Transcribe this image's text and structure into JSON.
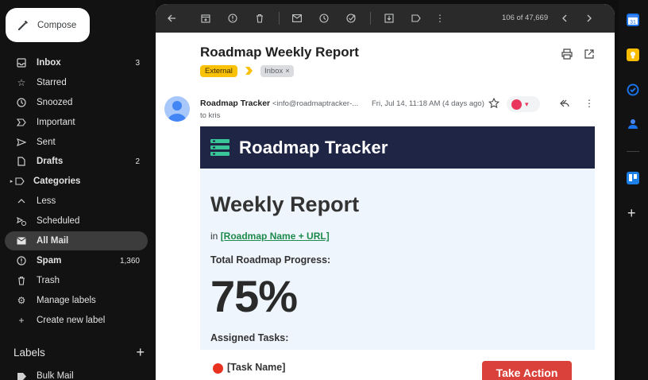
{
  "compose": {
    "label": "Compose"
  },
  "nav": {
    "items": [
      {
        "label": "Inbox",
        "count": "3",
        "icon": "inbox-icon"
      },
      {
        "label": "Starred",
        "count": "",
        "icon": "star-icon"
      },
      {
        "label": "Snoozed",
        "count": "",
        "icon": "clock-icon"
      },
      {
        "label": "Important",
        "count": "",
        "icon": "important-icon"
      },
      {
        "label": "Sent",
        "count": "",
        "icon": "send-icon"
      },
      {
        "label": "Drafts",
        "count": "2",
        "icon": "draft-icon"
      },
      {
        "label": "Categories",
        "count": "",
        "icon": "label-icon"
      },
      {
        "label": "Less",
        "count": "",
        "icon": "chevron-up-icon"
      },
      {
        "label": "Scheduled",
        "count": "",
        "icon": "scheduled-icon"
      },
      {
        "label": "All Mail",
        "count": "",
        "icon": "all-mail-icon"
      },
      {
        "label": "Spam",
        "count": "1,360",
        "icon": "spam-icon"
      },
      {
        "label": "Trash",
        "count": "",
        "icon": "trash-icon"
      },
      {
        "label": "Manage labels",
        "count": "",
        "icon": "gear-icon"
      },
      {
        "label": "Create new label",
        "count": "",
        "icon": "plus-icon"
      }
    ],
    "labels_heading": "Labels",
    "label_items": [
      {
        "label": "Bulk Mail"
      }
    ]
  },
  "toolbar": {
    "pager": "106 of 47,669"
  },
  "message": {
    "subject": "Roadmap Weekly Report",
    "tag_external": "External",
    "tag_inbox": "Inbox",
    "tag_inbox_close": "×",
    "sender_name": "Roadmap Tracker",
    "sender_addr": "<info@roadmaptracker-...",
    "date": "Fri, Jul 14, 11:18 AM (4 days ago)",
    "to": "to kris"
  },
  "email": {
    "brand": "Roadmap Tracker",
    "title": "Weekly Report",
    "in_prefix": "in",
    "roadmap_link": "[Roadmap Name + URL]",
    "progress_label": "Total Roadmap Progress:",
    "progress_value": "75%",
    "assigned_label": "Assigned Tasks:",
    "task_name": "[Task Name]",
    "action_label": "Take Action"
  },
  "colors": {
    "accent_banner": "#1f2544",
    "external_tag": "#f9c208",
    "link_green": "#1e8a4c",
    "action_red": "#d9413a"
  }
}
